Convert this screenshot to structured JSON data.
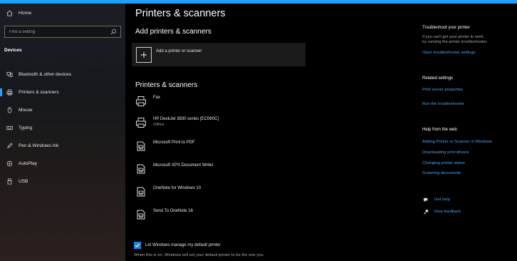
{
  "window": {
    "accent_color": "#1ea0ff"
  },
  "sidebar": {
    "home_label": "Home",
    "search": {
      "placeholder": "Find a setting"
    },
    "section_title": "Devices",
    "items": [
      {
        "label": "Bluetooth & other devices",
        "icon": "bluetooth-devices-icon"
      },
      {
        "label": "Printers & scanners",
        "icon": "printer-icon",
        "selected": true
      },
      {
        "label": "Mouse",
        "icon": "mouse-icon"
      },
      {
        "label": "Typing",
        "icon": "keyboard-icon"
      },
      {
        "label": "Pen & Windows Ink",
        "icon": "pen-icon"
      },
      {
        "label": "AutoPlay",
        "icon": "autoplay-icon"
      },
      {
        "label": "USB",
        "icon": "usb-icon"
      }
    ]
  },
  "main": {
    "title": "Printers & scanners",
    "add_heading": "Add printers & scanners",
    "add_button_label": "Add a printer or scanner",
    "list_heading": "Printers & scanners",
    "printers": [
      {
        "name": "Fax",
        "status": "",
        "icon": "printer-icon"
      },
      {
        "name": "HP DeskJet 3830 series [EC080C]",
        "status": "Offline",
        "icon": "printer-icon"
      },
      {
        "name": "Microsoft Print to PDF",
        "status": "",
        "icon": "document-printer-icon"
      },
      {
        "name": "Microsoft XPS Document Writer",
        "status": "",
        "icon": "document-printer-icon"
      },
      {
        "name": "OneNote for Windows 10",
        "status": "",
        "icon": "document-printer-icon"
      },
      {
        "name": "Send To OneNote 16",
        "status": "",
        "icon": "document-printer-icon"
      }
    ],
    "default_printer_checkbox": {
      "label": "Let Windows manage my default printer",
      "checked": true
    },
    "default_printer_desc": "When this is on, Windows will set your default printer to be the one you"
  },
  "right_panel": {
    "troubleshoot_heading": "Troubleshoot your printer",
    "troubleshoot_text_1": "If you can't get your printer to work,",
    "troubleshoot_text_2": "try running the printer troubleshooter.",
    "troubleshoot_link": "Open troubleshooter settings",
    "related_heading": "Related settings",
    "related_links": [
      "Print server properties",
      "Run the troubleshooter"
    ],
    "web_heading": "Help from the web",
    "web_links": [
      "Adding Printer or Scanner in Windows",
      "Downloading print drivers",
      "Changing printer status",
      "Scanning documents"
    ],
    "get_help": "Get help",
    "give_feedback": "Give feedback"
  }
}
